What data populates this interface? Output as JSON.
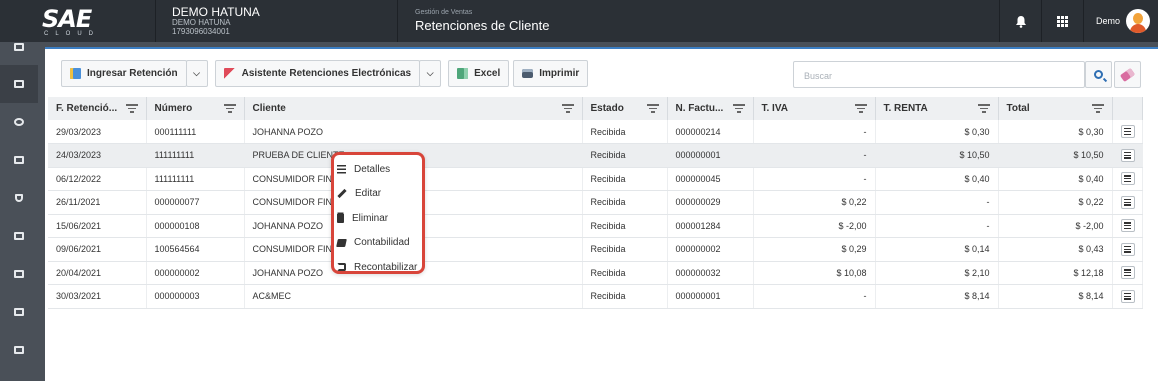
{
  "header": {
    "logo_text": "SAE",
    "logo_sub": "CLOUD",
    "company_name": "DEMO HATUNA",
    "company_sub": "DEMO HATUNA",
    "company_ruc": "1793096034001",
    "module_crumb": "Gestión de Ventas",
    "module_title": "Retenciones de Cliente",
    "user_name": "Demo",
    "icons": [
      "bell-icon",
      "apps-grid-icon",
      "user-avatar"
    ]
  },
  "sidebar": {
    "items": [
      "dashboard-icon",
      "invoice-icon",
      "pie-chart-icon",
      "card-icon",
      "shield-icon",
      "cart-icon",
      "bank-icon",
      "book-icon",
      "list-icon"
    ],
    "active_index": 1
  },
  "toolbar": {
    "ingresar_label": "Ingresar Retención",
    "asistente_label": "Asistente Retenciones Electrónicas",
    "excel_label": "Excel",
    "imprimir_label": "Imprimir",
    "search_placeholder": "Buscar"
  },
  "table": {
    "columns": [
      "F. Retenció...",
      "Número",
      "Cliente",
      "Estado",
      "N. Factu...",
      "T. IVA",
      "T. RENTA",
      "Total"
    ],
    "rows": [
      {
        "fecha": "29/03/2023",
        "numero": "000111111",
        "cliente": "JOHANNA POZO",
        "estado": "Recibida",
        "factura": "000000214",
        "iva": "-",
        "renta": "$ 0,30",
        "total": "$ 0,30"
      },
      {
        "fecha": "24/03/2023",
        "numero": "111111111",
        "cliente": "PRUEBA DE CLIENTE",
        "estado": "Recibida",
        "factura": "000000001",
        "iva": "-",
        "renta": "$ 10,50",
        "total": "$ 10,50"
      },
      {
        "fecha": "06/12/2022",
        "numero": "111111111",
        "cliente": "CONSUMIDOR FINAL",
        "estado": "Recibida",
        "factura": "000000045",
        "iva": "-",
        "renta": "$ 0,40",
        "total": "$ 0,40"
      },
      {
        "fecha": "26/11/2021",
        "numero": "000000077",
        "cliente": "CONSUMIDOR FINAL",
        "estado": "Recibida",
        "factura": "000000029",
        "iva": "$ 0,22",
        "renta": "-",
        "total": "$ 0,22"
      },
      {
        "fecha": "15/06/2021",
        "numero": "000000108",
        "cliente": "JOHANNA POZO",
        "estado": "Recibida",
        "factura": "000001284",
        "iva": "$ -2,00",
        "renta": "-",
        "total": "$ -2,00"
      },
      {
        "fecha": "09/06/2021",
        "numero": "100564564",
        "cliente": "CONSUMIDOR FINAL",
        "estado": "Recibida",
        "factura": "000000002",
        "iva": "$ 0,29",
        "renta": "$ 0,14",
        "total": "$ 0,43"
      },
      {
        "fecha": "20/04/2021",
        "numero": "000000002",
        "cliente": "JOHANNA POZO",
        "estado": "Recibida",
        "factura": "000000032",
        "iva": "$ 10,08",
        "renta": "$ 2,10",
        "total": "$ 12,18"
      },
      {
        "fecha": "30/03/2021",
        "numero": "000000003",
        "cliente": "AC&MEC",
        "estado": "Recibida",
        "factura": "000000001",
        "iva": "-",
        "renta": "$ 8,14",
        "total": "$ 8,14"
      }
    ],
    "selected_row": 1
  },
  "context_menu": {
    "items": [
      {
        "label": "Detalles",
        "icon": "list-icon"
      },
      {
        "label": "Editar",
        "icon": "pencil-icon"
      },
      {
        "label": "Eliminar",
        "icon": "trash-icon"
      },
      {
        "label": "Contabilidad",
        "icon": "book-icon"
      },
      {
        "label": "Recontabilizar",
        "icon": "cycle-icon"
      }
    ]
  },
  "colors": {
    "topbar": "#2b3036",
    "accent": "#3c7ec3",
    "highlight": "#d8453a"
  }
}
